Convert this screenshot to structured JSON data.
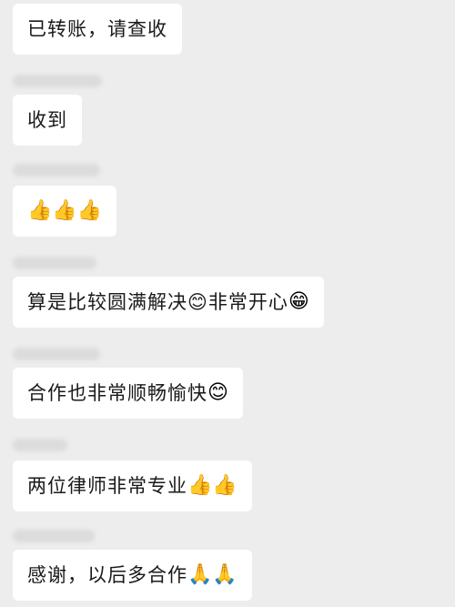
{
  "messages": [
    {
      "text": "已转账，请查收",
      "emoji": ""
    },
    {
      "text": "收到",
      "emoji": ""
    },
    {
      "text": "",
      "emoji": "👍👍👍"
    },
    {
      "text": "算是比较圆满解决😊非常开心",
      "emoji": "😁"
    },
    {
      "text": "合作也非常顺畅愉快",
      "emoji": "😊"
    },
    {
      "text": "两位律师非常专业",
      "emoji": "👍👍"
    },
    {
      "text": "感谢，以后多合作",
      "emoji": "🙏🙏"
    }
  ]
}
